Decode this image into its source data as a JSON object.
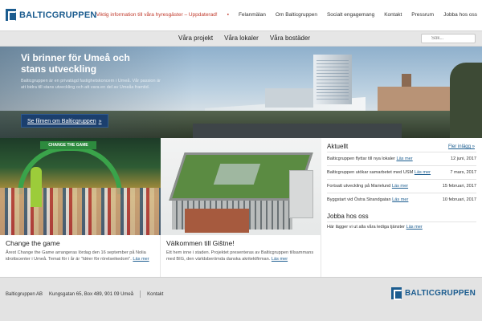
{
  "brand": {
    "name": "BALTICGRUPPEN"
  },
  "topnav": {
    "alert": "Viktig information till våra hyresgäster – Uppdaterad!",
    "items": [
      "Felanmälan",
      "Om Balticgruppen",
      "Socialt engagemang",
      "Kontakt",
      "Pressrum",
      "Jobba hos oss"
    ]
  },
  "mainnav": {
    "items": [
      "Våra projekt",
      "Våra lokaler",
      "Våra bostäder"
    ],
    "search_placeholder": "Sök..."
  },
  "hero": {
    "title": "Vi brinner för Umeå och stans utveckling",
    "text": "Balticgruppen är en privatägd fastighetskoncern i Umeå. Vår passion är att bidra till stans utveckling och att vara en del av Umeås framtid.",
    "button": "Se filmen om Balticgruppen",
    "button_arrow": "»"
  },
  "cards": [
    {
      "image_label": "CHANGE THE GAME",
      "title": "Change the game",
      "text": "Årest Change the Game arrangeras lördag den 16 september på Nolia idrottscenter i Umeå. Temat för i år är \"Idéer för rörelseikedom\".",
      "more": "Läs mer"
    },
    {
      "title": "Välkommen till Gištne!",
      "text": "Ett hem inne i staden. Projektet presenteras av Balticgruppen tillsammans med BIG, den världsberömda danska akritektfirman.",
      "more": "Läs mer"
    }
  ],
  "news": {
    "heading": "Aktuellt",
    "all_link": "Fler inlägg »",
    "more": "Läs mer",
    "items": [
      {
        "text": "Balticgruppen flyttar till nya lokaler",
        "date": "12 juni, 2017"
      },
      {
        "text": "Balticgruppen utökar samarbetet med USM",
        "date": "7 mars, 2017"
      },
      {
        "text": "Fortsatt utveckling på Marielund",
        "date": "15 februari, 2017"
      },
      {
        "text": "Byggstart vid Östra Strandgatan",
        "date": "10 februari, 2017"
      }
    ]
  },
  "jobs": {
    "heading": "Jobba hos oss",
    "text": "Här lägger vi ut alla våra lediga tjänster",
    "more": "Läs mer"
  },
  "footer": {
    "company": "Balticgruppen AB",
    "address": "Kungsgatan 65, Box 489, 901 09 Umeå",
    "contact": "Kontakt"
  },
  "colors": {
    "brand": "#1b5c8f",
    "alert": "#c0392b",
    "button": "#1b3f6e"
  }
}
